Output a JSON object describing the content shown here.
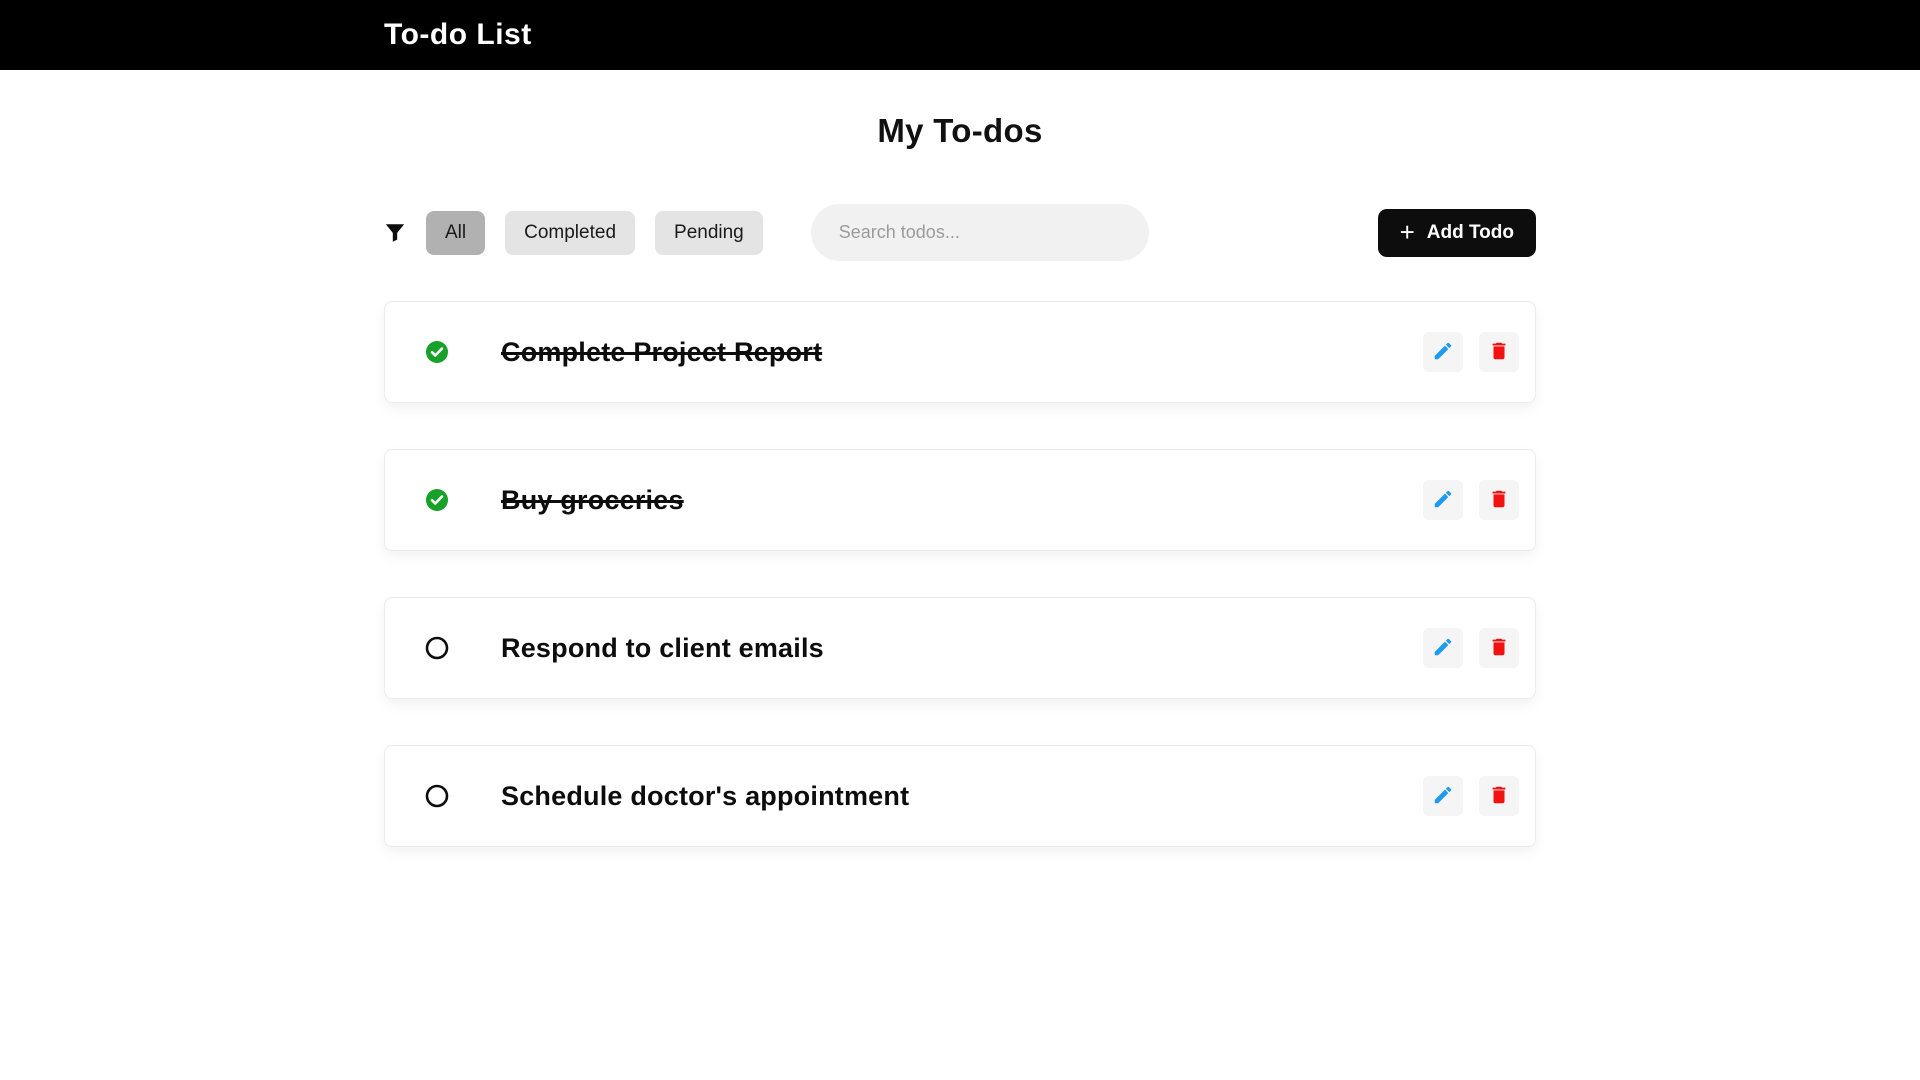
{
  "header": {
    "title": "To-do List"
  },
  "page": {
    "heading": "My To-dos"
  },
  "toolbar": {
    "filters": [
      {
        "label": "All",
        "active": true
      },
      {
        "label": "Completed",
        "active": false
      },
      {
        "label": "Pending",
        "active": false
      }
    ],
    "search": {
      "placeholder": "Search todos...",
      "value": ""
    },
    "add_button": {
      "label": "Add Todo",
      "plus_glyph": "+"
    }
  },
  "todos": [
    {
      "title": "Complete Project Report",
      "completed": true
    },
    {
      "title": "Buy groceries",
      "completed": true
    },
    {
      "title": "Respond to client emails",
      "completed": false
    },
    {
      "title": "Schedule doctor's appointment",
      "completed": false
    }
  ],
  "icons": {
    "filter": "filter-funnel-icon",
    "check": "check-circle-icon",
    "pending": "empty-circle-icon",
    "edit": "pencil-icon",
    "delete": "trash-icon"
  },
  "colors": {
    "header_bg": "#000000",
    "active_filter_bg": "#b1b1b1",
    "inactive_filter_bg": "#e4e4e4",
    "search_bg": "#f1f1f1",
    "add_button_bg": "#0d0d0d",
    "check_green": "#17a12b",
    "edit_blue": "#1e9bf0",
    "delete_red": "#f21212"
  }
}
